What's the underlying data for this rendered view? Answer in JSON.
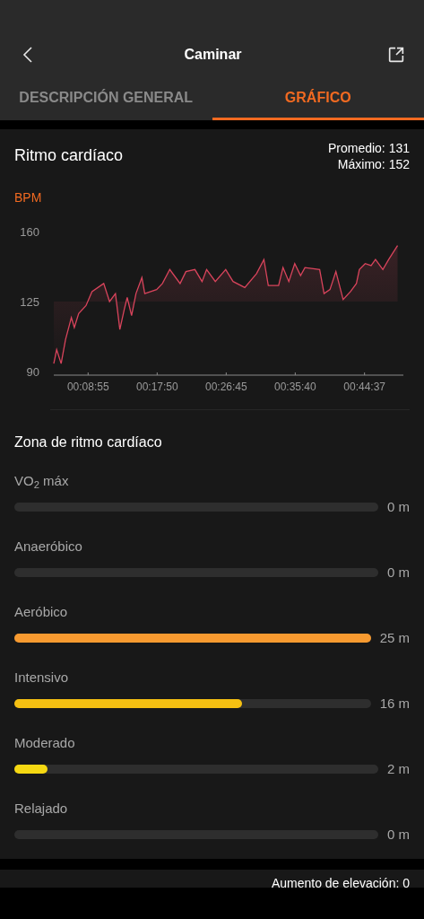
{
  "header": {
    "title": "Caminar"
  },
  "tabs": [
    {
      "label": "DESCRIPCIÓN GENERAL",
      "selected": false
    },
    {
      "label": "GRÁFICO",
      "selected": true
    }
  ],
  "heart_rate": {
    "title": "Ritmo cardíaco",
    "average": "Promedio: 131",
    "maximum": "Máximo: 152",
    "unit": "BPM",
    "chart_data": {
      "type": "line",
      "xlim": [
        269,
        2978
      ],
      "ylim": [
        90,
        160
      ],
      "yticks": [
        90,
        125,
        160
      ],
      "xticks": [
        {
          "value": 535,
          "label": "00:08:55"
        },
        {
          "value": 1070,
          "label": "00:17:50"
        },
        {
          "value": 1605,
          "label": "00:26:45"
        },
        {
          "value": 2140,
          "label": "00:35:40"
        },
        {
          "value": 2677,
          "label": "00:44:37"
        }
      ],
      "x": [
        269,
        291,
        326,
        360,
        405,
        428,
        462,
        519,
        565,
        656,
        701,
        747,
        781,
        815,
        838,
        872,
        906,
        952,
        974,
        1066,
        1111,
        1168,
        1248,
        1293,
        1362,
        1418,
        1453,
        1521,
        1601,
        1658,
        1749,
        1840,
        1897,
        1931,
        2011,
        2045,
        2090,
        2136,
        2181,
        2215,
        2329,
        2363,
        2409,
        2455,
        2511,
        2568,
        2614,
        2637,
        2682,
        2728,
        2762,
        2819,
        2864,
        2933
      ],
      "series": [
        {
          "color": "#d9445c",
          "values": [
            94,
            101,
            94,
            106,
            117,
            112,
            119,
            123,
            130,
            134,
            125,
            129,
            111,
            121,
            127,
            118,
            129,
            137,
            129,
            131,
            134,
            141,
            134,
            140,
            141,
            135,
            141,
            135,
            141,
            135,
            132,
            139,
            146,
            133,
            133,
            142,
            135,
            144,
            138,
            142,
            141,
            129,
            131,
            140,
            126,
            130,
            134,
            141,
            144,
            143,
            146,
            141,
            146,
            153
          ]
        }
      ]
    }
  },
  "zones": {
    "title": "Zona de ritmo cardíaco",
    "items": [
      {
        "label": "VO$_{2}$ máx",
        "value": "0 m"
      },
      {
        "label": "Anaeróbico",
        "value": "0 m"
      },
      {
        "label": "Aeróbico",
        "level": 1,
        "value": "25 m",
        "color": "#f79a30"
      },
      {
        "label": "Intensivo",
        "level": 0.64,
        "value": "16 m",
        "color": "#f5c012"
      },
      {
        "label": "Moderado",
        "level": 0.09,
        "value": "2 m",
        "color": "#f5d812"
      },
      {
        "label": "Relajado",
        "value": "0 m"
      }
    ]
  },
  "altitude": {
    "elevation_gain": "Aumento de elevación: 0"
  }
}
